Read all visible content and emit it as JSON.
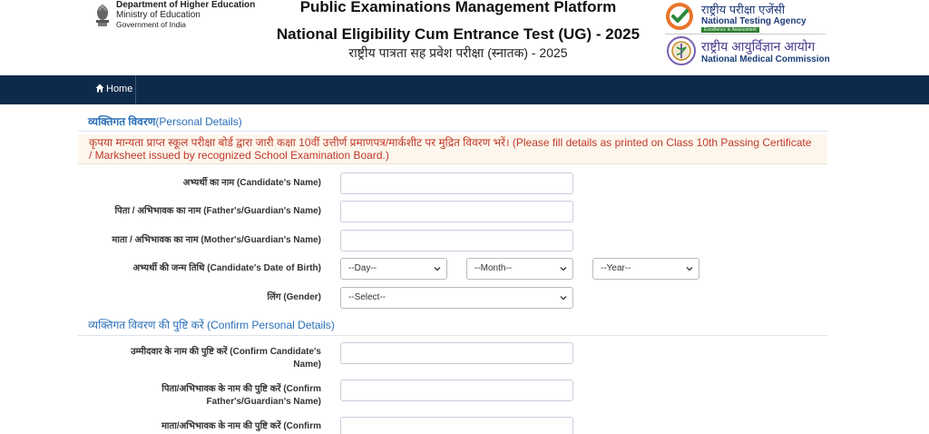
{
  "header": {
    "ministry": {
      "line1": "Department of Higher Education",
      "line2": "Ministry of Education",
      "line3": "Government of India"
    },
    "title_line1": "Public Examinations Management Platform",
    "title_line2": "National Eligibility Cum Entrance Test (UG) - 2025",
    "title_line3": "राष्ट्रीय पात्रता सह प्रवेश परीक्षा (स्नातक) - 2025",
    "nta": {
      "hindi": "राष्ट्रीय परीक्षा एजेंसी",
      "english": "National Testing Agency",
      "tagline": "Excellence in Assessment"
    },
    "nmc": {
      "hindi": "राष्ट्रीय आयुर्विज्ञान आयोग",
      "english": "National Medical Commission"
    }
  },
  "nav": {
    "home_label": "Home"
  },
  "form": {
    "personal_title_hi": "व्यक्तिगत विवरण",
    "personal_title_en": "(Personal Details)",
    "notice": "कृपया मान्यता प्राप्त स्कूल परीक्षा बोर्ड द्वारा जारी कक्षा 10वीं उत्तीर्ण प्रमाणपत्र/मार्कशीट पर मुद्रित विवरण भरें। (Please fill details as printed on Class 10th Passing Certificate / Marksheet issued by recognized School Examination Board.)",
    "candidate_name_label": "अभ्यर्थी का नाम (Candidate's Name)",
    "candidate_name_value": "",
    "father_name_label": "पिता / अभिभावक का नाम (Father's/Guardian's Name)",
    "father_name_value": "",
    "mother_name_label": "माता / अभिभावक का नाम (Mother's/Guardian's Name)",
    "mother_name_value": "",
    "dob_label": "अभ्यर्थी की जन्म तिथि (Candidate's Date of Birth)",
    "dob_day": "--Day--",
    "dob_month": "--Month--",
    "dob_year": "--Year--",
    "gender_label": "लिंग (Gender)",
    "gender_value": "--Select--",
    "confirm_title": "व्यक्तिगत विवरण की पुष्टि करें (Confirm Personal Details)",
    "confirm_candidate_label_1": "उम्मीदवार के नाम की पुष्टि करें (Confirm Candidate's",
    "confirm_candidate_label_2": "Name)",
    "confirm_candidate_value": "",
    "confirm_father_label_1": "पिता/अभिभावक के नाम की पुष्टि करें (Confirm",
    "confirm_father_label_2": "Father's/Guardian's Name)",
    "confirm_father_value": "",
    "confirm_mother_label_1": "माता/अभिभावक के नाम की पुष्टि करें (Confirm",
    "confirm_mother_value": ""
  }
}
